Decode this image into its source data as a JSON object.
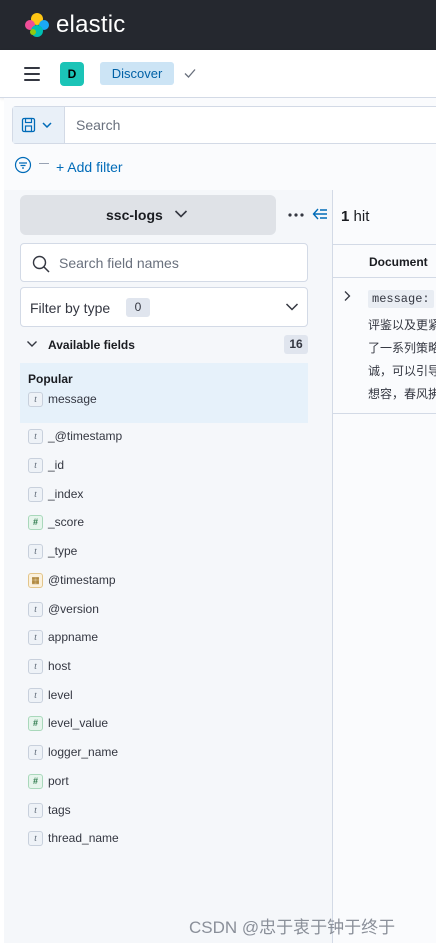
{
  "header": {
    "brand": "elastic",
    "logo_icon": "elastic-logo-icon"
  },
  "breadcrumbs": {
    "space_initial": "D",
    "current": "Discover"
  },
  "query_bar": {
    "placeholder": "Search"
  },
  "filters": {
    "add_filter_label": "+ Add filter"
  },
  "sidebar": {
    "index_pattern": "ssc-logs",
    "field_search_placeholder": "Search field names",
    "filter_by_type_label": "Filter by type",
    "filter_by_type_count": "0",
    "available_fields_label": "Available fields",
    "available_fields_count": "16",
    "popular_label": "Popular",
    "popular_fields": [
      {
        "type": "string",
        "type_glyph": "t",
        "name": "message"
      }
    ],
    "fields": [
      {
        "type": "string",
        "type_glyph": "t",
        "name": "_@timestamp"
      },
      {
        "type": "string",
        "type_glyph": "t",
        "name": "_id"
      },
      {
        "type": "string",
        "type_glyph": "t",
        "name": "_index"
      },
      {
        "type": "number",
        "type_glyph": "#",
        "name": "_score"
      },
      {
        "type": "string",
        "type_glyph": "t",
        "name": "_type"
      },
      {
        "type": "date",
        "type_glyph": "▦",
        "name": "@timestamp"
      },
      {
        "type": "string",
        "type_glyph": "t",
        "name": "@version"
      },
      {
        "type": "string",
        "type_glyph": "t",
        "name": "appname"
      },
      {
        "type": "string",
        "type_glyph": "t",
        "name": "host"
      },
      {
        "type": "string",
        "type_glyph": "t",
        "name": "level"
      },
      {
        "type": "number",
        "type_glyph": "#",
        "name": "level_value"
      },
      {
        "type": "string",
        "type_glyph": "t",
        "name": "logger_name"
      },
      {
        "type": "number",
        "type_glyph": "#",
        "name": "port"
      },
      {
        "type": "string",
        "type_glyph": "t",
        "name": "tags"
      },
      {
        "type": "string",
        "type_glyph": "t",
        "name": "thread_name"
      }
    ]
  },
  "results": {
    "hit_count": "1",
    "hit_label": "hit",
    "column_header": "Document",
    "doc_key": "message:",
    "doc_lines": [
      "评鉴以及更紧",
      "了一系列策略",
      "诚，可以引导",
      "想容，春风拂"
    ]
  },
  "watermark": "CSDN @忠于衷于钟于终于"
}
